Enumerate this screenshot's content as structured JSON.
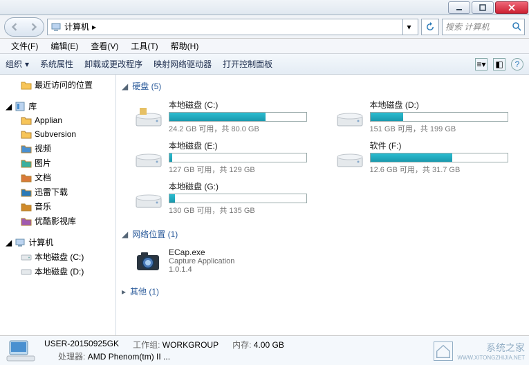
{
  "titlebar": {
    "close": "×"
  },
  "nav": {
    "crumb1": "计算机",
    "search_placeholder": "搜索 计算机"
  },
  "menu": {
    "file": "文件(F)",
    "edit": "编辑(E)",
    "view": "查看(V)",
    "tools": "工具(T)",
    "help": "帮助(H)"
  },
  "toolbar": {
    "organize": "组织",
    "sysprops": "系统属性",
    "uninstall": "卸载或更改程序",
    "mapdrive": "映射网络驱动器",
    "ctrlpanel": "打开控制面板"
  },
  "sidebar": {
    "recent": "最近访问的位置",
    "libraries": "库",
    "items": [
      "Applian",
      "Subversion",
      "视频",
      "图片",
      "文档",
      "迅雷下载",
      "音乐",
      "优酷影视库"
    ],
    "computer": "计算机",
    "drive_c": "本地磁盘 (C:)",
    "drive_d": "本地磁盘 (D:)"
  },
  "content": {
    "section_drives": "硬盘 (5)",
    "section_net": "网络位置 (1)",
    "section_other": "其他 (1)",
    "drives": [
      {
        "name": "本地磁盘 (C:)",
        "info": "24.2 GB 可用，共 80.0 GB",
        "pct": 70
      },
      {
        "name": "本地磁盘 (D:)",
        "info": "151 GB 可用，共 199 GB",
        "pct": 24
      },
      {
        "name": "本地磁盘 (E:)",
        "info": "127 GB 可用，共 129 GB",
        "pct": 2
      },
      {
        "name": "软件 (F:)",
        "info": "12.6 GB 可用，共 31.7 GB",
        "pct": 60
      },
      {
        "name": "本地磁盘 (G:)",
        "info": "130 GB 可用，共 135 GB",
        "pct": 4
      }
    ],
    "net": {
      "name": "ECap.exe",
      "desc": "Capture Application",
      "ver": "1.0.1.4"
    }
  },
  "details": {
    "hostname": "USER-20150925GK",
    "workgroup_lbl": "工作组:",
    "workgroup": "WORKGROUP",
    "mem_lbl": "内存:",
    "mem": "4.00 GB",
    "cpu_lbl": "处理器:",
    "cpu": "AMD Phenom(tm) II ..."
  },
  "watermark": {
    "brand": "系统之家",
    "url": "WWW.XITONGZHIJIA.NET"
  }
}
